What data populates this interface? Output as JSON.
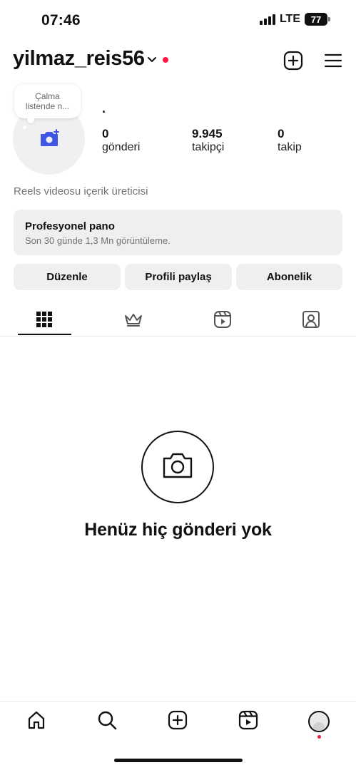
{
  "status_bar": {
    "time": "07:46",
    "network": "LTE",
    "battery": "77"
  },
  "header": {
    "username": "yilmaz_reis56"
  },
  "profile": {
    "note": [
      "Çalma",
      "listende n..."
    ],
    "display_name": ".",
    "stats": [
      {
        "value": "0",
        "label": "gönderi"
      },
      {
        "value": "9.945",
        "label": "takipçi"
      },
      {
        "value": "0",
        "label": "takip"
      }
    ],
    "bio": "Reels videosu içerik üreticisi"
  },
  "dashboard": {
    "title": "Profesyonel pano",
    "subtitle": "Son 30 günde 1,3 Mn görüntüleme."
  },
  "actions": {
    "edit": "Düzenle",
    "share": "Profili paylaş",
    "subscription": "Abonelik"
  },
  "tabs": [
    "grid-icon",
    "crown-icon",
    "reels-icon",
    "tagged-icon"
  ],
  "empty_state": {
    "message": "Henüz hiç gönderi yok"
  },
  "bottom_nav": [
    "home-icon",
    "search-icon",
    "create-icon",
    "reels-icon",
    "profile-avatar"
  ]
}
